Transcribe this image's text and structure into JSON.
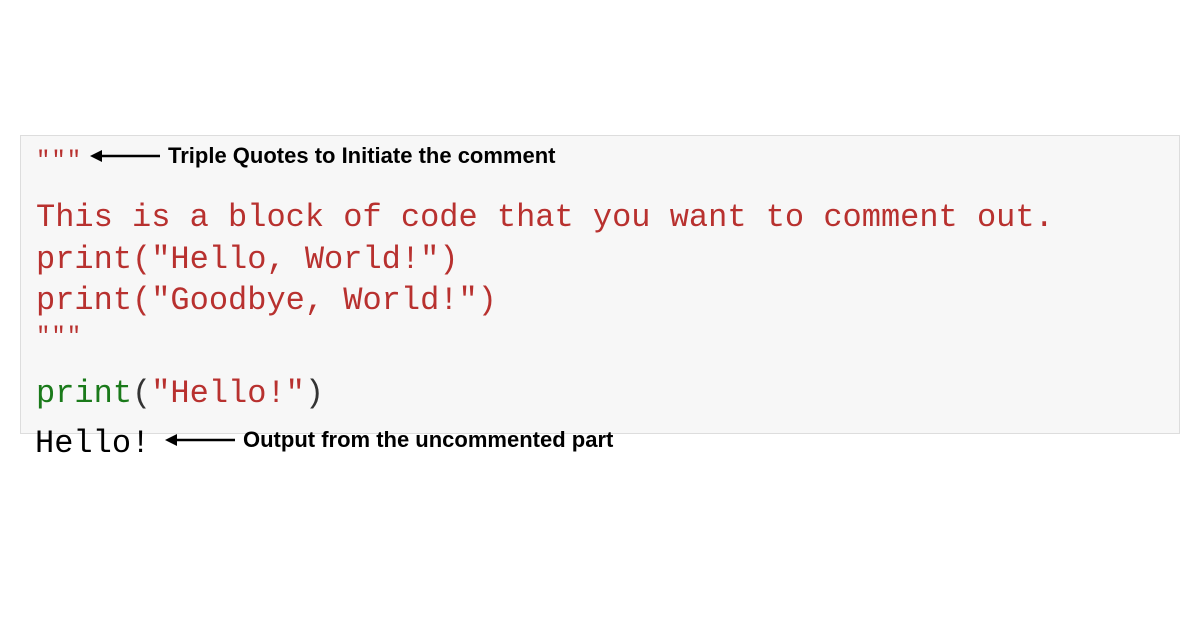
{
  "code": {
    "open_quotes": "\"\"\"",
    "line1": "This is a block of code that you want to comment out.",
    "line2_fn": "print",
    "line2_open": "(",
    "line2_str": "\"Hello, World!\"",
    "line2_close": ")",
    "line3_fn": "print",
    "line3_open": "(",
    "line3_str": "\"Goodbye, World!\"",
    "line3_close": ")",
    "close_quotes": "\"\"\"",
    "line4_fn": "print",
    "line4_open": "(",
    "line4_str": "\"Hello!\"",
    "line4_close": ")"
  },
  "output": {
    "text": "Hello!"
  },
  "annotations": {
    "top": "Triple Quotes to Initiate the comment",
    "bottom": "Output from the uncommented part"
  }
}
